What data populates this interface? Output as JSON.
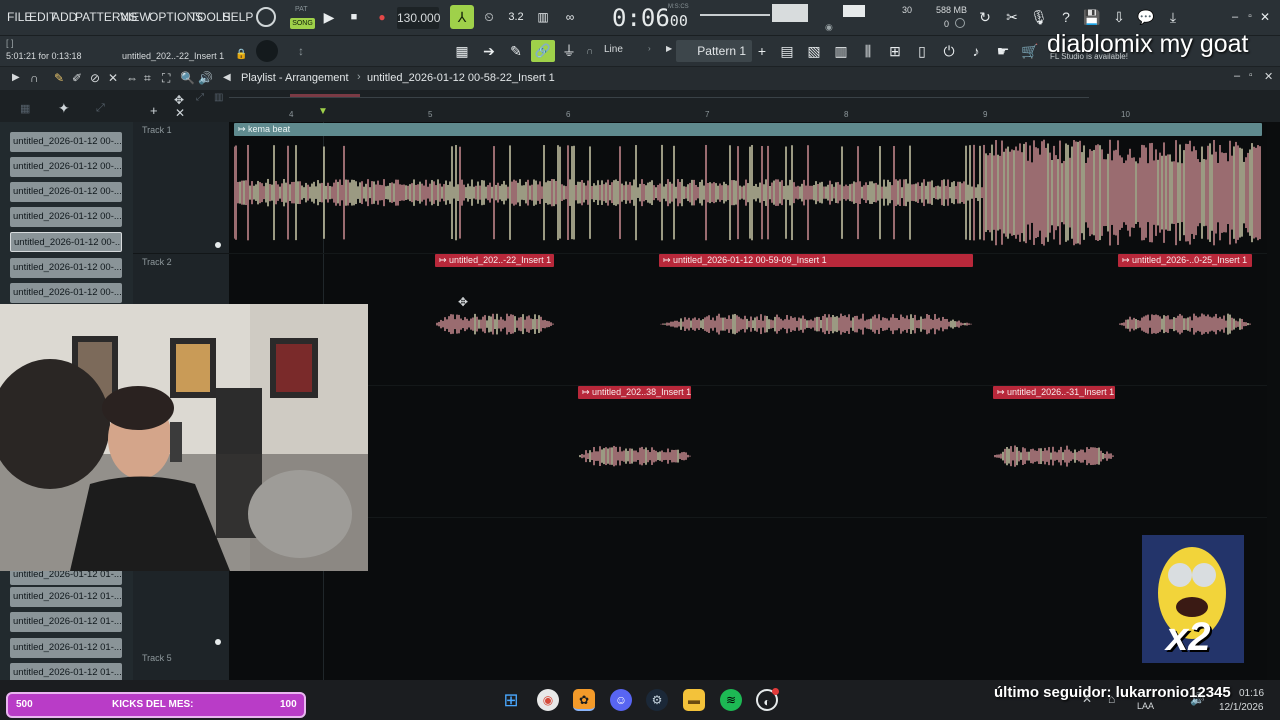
{
  "menu": [
    "FILE",
    "EDIT",
    "ADD",
    "PATTERNS",
    "VIEW",
    "OPTIONS",
    "TOOLS",
    "HELP"
  ],
  "transport": {
    "pat_label": "PAT",
    "song_label": "SONG",
    "tempo": "130.000",
    "time": "0:06",
    "time_small": "00",
    "time_caption": "M:S:CS",
    "cpu": "30",
    "memory": "588 MB",
    "poly": "0"
  },
  "hint": {
    "bracket": "[ ]",
    "position": "5:01:21 for 0:13:18",
    "clip": "untitled_202..-22_Insert 1",
    "fl_notice": "FL Studio is available!"
  },
  "toolbar": {
    "snap": "Line",
    "pattern": "Pattern 1"
  },
  "playlist": {
    "title": "Playlist - Arrangement",
    "breadcrumb_sep": "›",
    "arrangement": "untitled_2026-01-12 00-58-22_Insert 1"
  },
  "ruler": [
    "4",
    "5",
    "6",
    "7",
    "8",
    "9",
    "10"
  ],
  "browser_items_top": [
    "untitled_2026-01-12 00-...",
    "untitled_2026-01-12 00-...",
    "untitled_2026-01-12 00-...",
    "untitled_2026-01-12 00-...",
    "untitled_2026-01-12 00-...",
    "untitled_2026-01-12 00-...",
    "untitled_2026-01-12 00-..."
  ],
  "browser_items_bottom": [
    "untitled_2026-01-12 01-...",
    "untitled_2026-01-12 01-...",
    "untitled_2026-01-12 01-...",
    "untitled_2026-01-12 01-...",
    "untitled_2026-01-12 01-..."
  ],
  "tracks": [
    "Track 1",
    "Track 2",
    "Track 5"
  ],
  "clips": {
    "beat": "kema beat",
    "t2a": "untitled_202..-22_Insert 1",
    "t2b": "untitled_2026-01-12 00-59-09_Insert 1",
    "t2c": "untitled_2026-..0-25_Insert 1",
    "t3a": "untitled_202..38_Insert 1",
    "t3b": "untitled_2026..-31_Insert 1"
  },
  "overlay": {
    "title": "diablomix my goat",
    "follower": "último seguidor: lukarronio12345",
    "minion_badge": "x2"
  },
  "kicks": {
    "left": "500",
    "label": "KICKS DEL MES:",
    "right": "100"
  },
  "tray": {
    "lang": "LAA",
    "clock": "01:16",
    "date": "12/1/2026"
  },
  "colors": {
    "beat_clip": "#5f8a8e",
    "vocal_clip": "#b8283a",
    "wave_green": "#e9e6c2",
    "wave_pink": "#e8a0a6"
  }
}
